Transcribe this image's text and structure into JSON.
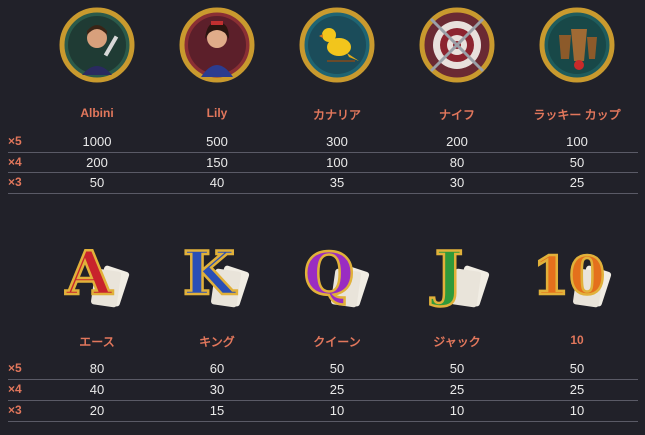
{
  "premium": {
    "symbols": [
      {
        "name": "Albini",
        "icon": "magician-portrait-icon",
        "x5": "1000",
        "x4": "200",
        "x3": "50"
      },
      {
        "name": "Lily",
        "icon": "lady-portrait-icon",
        "x5": "500",
        "x4": "150",
        "x3": "40"
      },
      {
        "name": "カナリア",
        "icon": "canary-bird-icon",
        "x5": "300",
        "x4": "100",
        "x3": "35"
      },
      {
        "name": "ナイフ",
        "icon": "knife-target-icon",
        "x5": "200",
        "x4": "80",
        "x3": "30"
      },
      {
        "name": "ラッキー カップ",
        "icon": "lucky-cups-icon",
        "x5": "100",
        "x4": "50",
        "x3": "25"
      }
    ]
  },
  "royals": {
    "symbols": [
      {
        "name": "エース",
        "letter": "A",
        "icon": "ace-card-icon",
        "x5": "80",
        "x4": "40",
        "x3": "20"
      },
      {
        "name": "キング",
        "letter": "K",
        "icon": "king-card-icon",
        "x5": "60",
        "x4": "30",
        "x3": "15"
      },
      {
        "name": "クイーン",
        "letter": "Q",
        "icon": "queen-card-icon",
        "x5": "50",
        "x4": "25",
        "x3": "10"
      },
      {
        "name": "ジャック",
        "letter": "J",
        "icon": "jack-card-icon",
        "x5": "50",
        "x4": "25",
        "x3": "10"
      },
      {
        "name": "10",
        "letter": "10",
        "icon": "ten-card-icon",
        "x5": "50",
        "x4": "25",
        "x3": "10"
      }
    ]
  },
  "multipliers": {
    "x5": "×5",
    "x4": "×4",
    "x3": "×3"
  },
  "colors": {
    "background": "#212129",
    "label": "#e2775c",
    "value": "#eaeaea",
    "divider": "#5a5a66",
    "gold": "#c99a2e"
  }
}
